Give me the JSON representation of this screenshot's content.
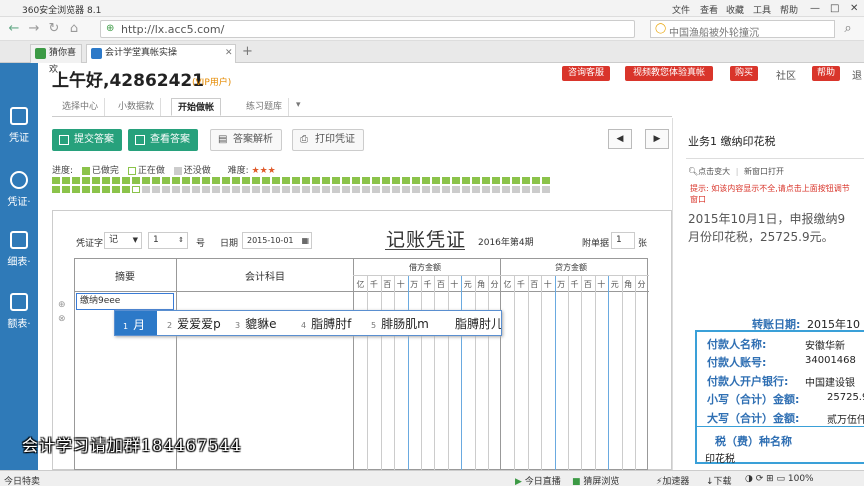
{
  "browser": {
    "app_title": "360安全浏览器 8.1",
    "menu": [
      "文件",
      "查看",
      "收藏",
      "工具",
      "帮助"
    ],
    "url": "http://lx.acc5.com/",
    "search_placeholder": "中国渔船被外轮撞沉",
    "tabs": [
      {
        "label": "猜你喜欢"
      },
      {
        "label": "会计学堂真帐实操",
        "active": true
      }
    ],
    "tab_add": "+"
  },
  "sidebar": {
    "items": [
      {
        "label": "凭证",
        "icon": "ledger-icon"
      },
      {
        "label": "凭证·",
        "icon": "search-icon"
      },
      {
        "label": "细表·",
        "icon": "list-icon"
      },
      {
        "label": "额表·",
        "icon": "table-icon"
      }
    ]
  },
  "header": {
    "greeting": "上午好,42862421",
    "vip": "(VIP用户)",
    "buttons": [
      "咨询客服",
      "视频教您体验真帐",
      "购买"
    ],
    "community": "社区",
    "help": "帮助",
    "exit": "退"
  },
  "subtabs": [
    "选择中心",
    "小数据款",
    "开始做帐",
    "练习题库"
  ],
  "actions": {
    "submit": "提交答案",
    "view": "查看答案",
    "analysis": "答案解析",
    "print": "打印凭证",
    "prev": "◀",
    "next": "▶"
  },
  "progress": {
    "legend_label": "进度:",
    "done": "已做完",
    "doing": "正在做",
    "todo": "还没做",
    "difficulty_label": "难度:",
    "difficulty_stars": 3,
    "completed_count": 58,
    "current_index": 58,
    "total_count": 100,
    "done_color": "#8bc34a"
  },
  "voucher": {
    "title": "记账凭证",
    "period": "2016年第4期",
    "type_label": "凭证字",
    "type_value": "记",
    "number_value": "1",
    "number_suffix": "号",
    "date_label": "日期",
    "date_value": "2015-10-01",
    "attach_label": "附单据",
    "attach_value": "1",
    "attach_suffix": "张",
    "col_summary": "摘要",
    "col_account": "会计科目",
    "col_debit": "借方金额",
    "col_credit": "贷方金额",
    "digit_labels": [
      "亿",
      "千",
      "百",
      "十",
      "万",
      "千",
      "百",
      "十",
      "元",
      "角",
      "分"
    ],
    "summary_input": "缴纳9eee"
  },
  "ime": {
    "candidates": [
      {
        "n": "1",
        "text": "月"
      },
      {
        "n": "2",
        "text": "爱爱爱p"
      },
      {
        "n": "3",
        "text": "貔貅e"
      },
      {
        "n": "4",
        "text": "脂膊肘f"
      },
      {
        "n": "5",
        "text": "腓肠肌m"
      },
      {
        "n": "",
        "text": "脂膊肘儿"
      }
    ]
  },
  "right_panel": {
    "title": "业务1 缴纳印花税",
    "zoom": "点击变大",
    "new_window": "新窗口打开",
    "warning": "提示: 如该内容显示不全,请点击上面按钮调节窗口",
    "description": "2015年10月1日，申报缴纳9月份印花税，25725.9元。",
    "transfer_date_label": "转账日期:",
    "transfer_date_value": "2015年10",
    "fields": [
      {
        "label": "付款人名称:",
        "value": "安徽华新"
      },
      {
        "label": "付款人账号:",
        "value": "34001468"
      },
      {
        "label": "付款人开户银行:",
        "value": "中国建设银"
      },
      {
        "label": "小写（合计）金额:",
        "value": "25725.90"
      },
      {
        "label": "大写（合计）金额:",
        "value": "贰万伍仟"
      }
    ],
    "tax_type_label": "税（费）种名称",
    "tax_type_value": "印花税"
  },
  "watermark": "会计学习请加群184467544",
  "statusbar": {
    "left": "今日特卖",
    "items": [
      "今日直播",
      "猜屏浏览",
      "加速器",
      "下载"
    ]
  }
}
